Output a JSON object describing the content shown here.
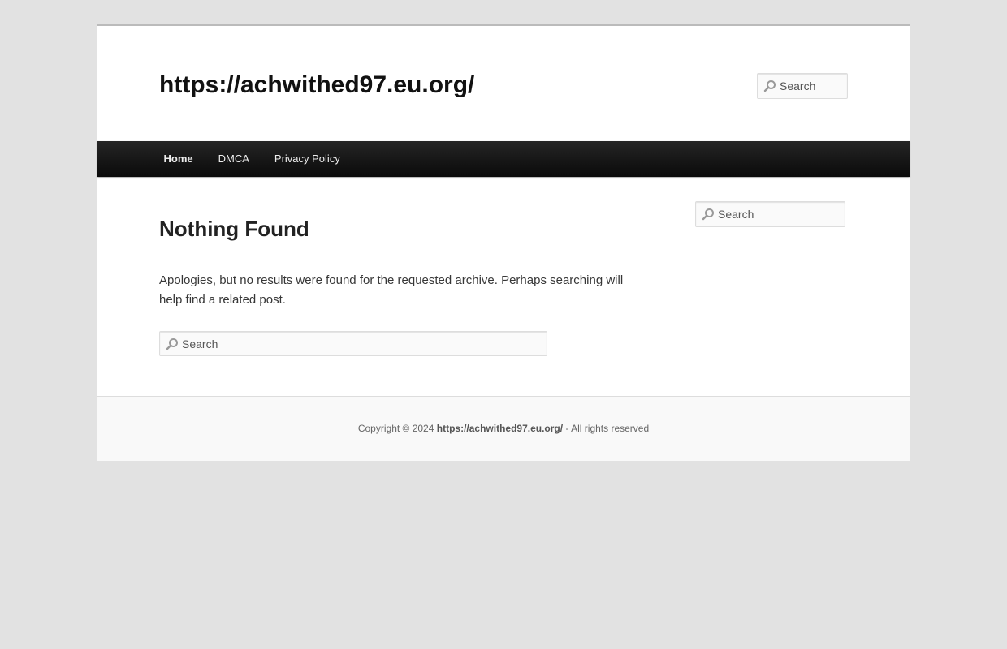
{
  "site": {
    "title": "https://achwithed97.eu.org/"
  },
  "header_search": {
    "placeholder": "Search"
  },
  "nav": {
    "items": [
      {
        "label": "Home"
      },
      {
        "label": "DMCA"
      },
      {
        "label": "Privacy Policy"
      }
    ]
  },
  "sidebar_search": {
    "placeholder": "Search"
  },
  "main": {
    "title": "Nothing Found",
    "message": "Apologies, but no results were found for the requested archive. Perhaps searching will help find a related post.",
    "search_placeholder": "Search"
  },
  "footer": {
    "prefix": "Copyright © 2024 ",
    "site_link": "https://achwithed97.eu.org/",
    "suffix": " - All rights reserved"
  },
  "icons": {
    "search": "search-icon"
  },
  "colors": {
    "page_background": "#e2e2e2",
    "nav_background": "#1b1b1b",
    "footer_background": "#f9f9f9"
  }
}
